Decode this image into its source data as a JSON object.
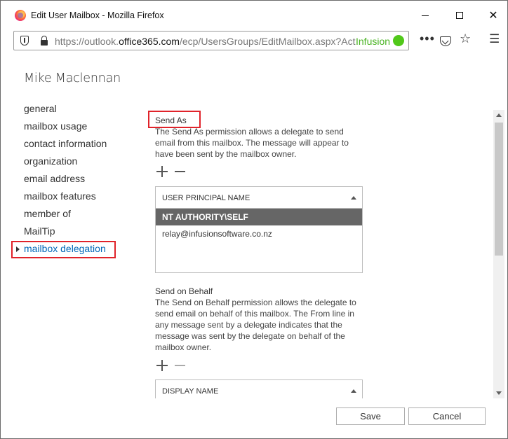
{
  "window": {
    "title": "Edit User Mailbox - Mozilla Firefox",
    "min_icon": "minimize-icon",
    "max_icon": "maximize-icon",
    "close_glyph": "✕"
  },
  "browser": {
    "url_prefix": "https://outlook.",
    "url_domain": "office365.com",
    "url_path": "/ecp/UsersGroups/EditMailbox.aspx?Act",
    "extension_label": "Infusion",
    "extension_color": "#51c81a",
    "dots_glyph": "•••",
    "star_glyph": "☆",
    "menu_glyph": "☰"
  },
  "page": {
    "title": "Mike Maclennan"
  },
  "nav": {
    "items": [
      {
        "label": "general"
      },
      {
        "label": "mailbox usage"
      },
      {
        "label": "contact information"
      },
      {
        "label": "organization"
      },
      {
        "label": "email address"
      },
      {
        "label": "mailbox features"
      },
      {
        "label": "member of"
      },
      {
        "label": "MailTip"
      },
      {
        "label": "mailbox delegation",
        "active": true
      }
    ],
    "active_color": "#0067b8",
    "highlight_color": "#e0232a"
  },
  "send_as": {
    "title": "Send As",
    "description": "The Send As permission allows a delegate to send email from this mailbox. The message will appear to have been sent by the mailbox owner.",
    "column_header": "USER PRINCIPAL NAME",
    "rows": [
      {
        "value": "NT AUTHORITY\\SELF",
        "selected": true
      },
      {
        "value": "relay@infusionsoftware.co.nz"
      }
    ]
  },
  "send_on_behalf": {
    "title": "Send on Behalf",
    "description": "The Send on Behalf permission allows the delegate to send email on behalf of this mailbox. The From line in any message sent by a delegate indicates that the message was sent by the delegate on behalf of the mailbox owner.",
    "column_header": "DISPLAY NAME"
  },
  "footer": {
    "save_label": "Save",
    "cancel_label": "Cancel"
  }
}
